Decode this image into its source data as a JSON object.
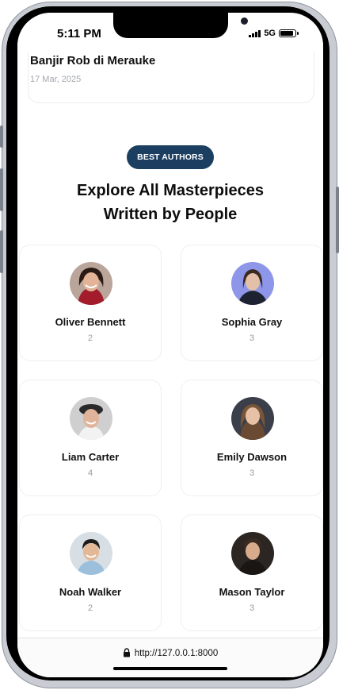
{
  "status_bar": {
    "time": "5:11 PM",
    "network": "5G",
    "battery_level": 0.9
  },
  "news_card": {
    "title": "Banjir Rob di Merauke",
    "date": "17 Mar, 2025"
  },
  "section": {
    "badge": "BEST AUTHORS",
    "heading_line1": "Explore All Masterpieces",
    "heading_line2": "Written by People"
  },
  "authors": [
    {
      "name": "Oliver Bennett",
      "count": "2"
    },
    {
      "name": "Sophia Gray",
      "count": "3"
    },
    {
      "name": "Liam Carter",
      "count": "4"
    },
    {
      "name": "Emily Dawson",
      "count": "3"
    },
    {
      "name": "Noah Walker",
      "count": "2"
    },
    {
      "name": "Mason Taylor",
      "count": "3"
    }
  ],
  "browser": {
    "url": "http://127.0.0.1:8000",
    "lock_icon": "lock-icon"
  },
  "colors": {
    "badge_bg": "#1b3e61",
    "card_border": "#eeeff2",
    "muted_text": "#9a9ca3"
  }
}
